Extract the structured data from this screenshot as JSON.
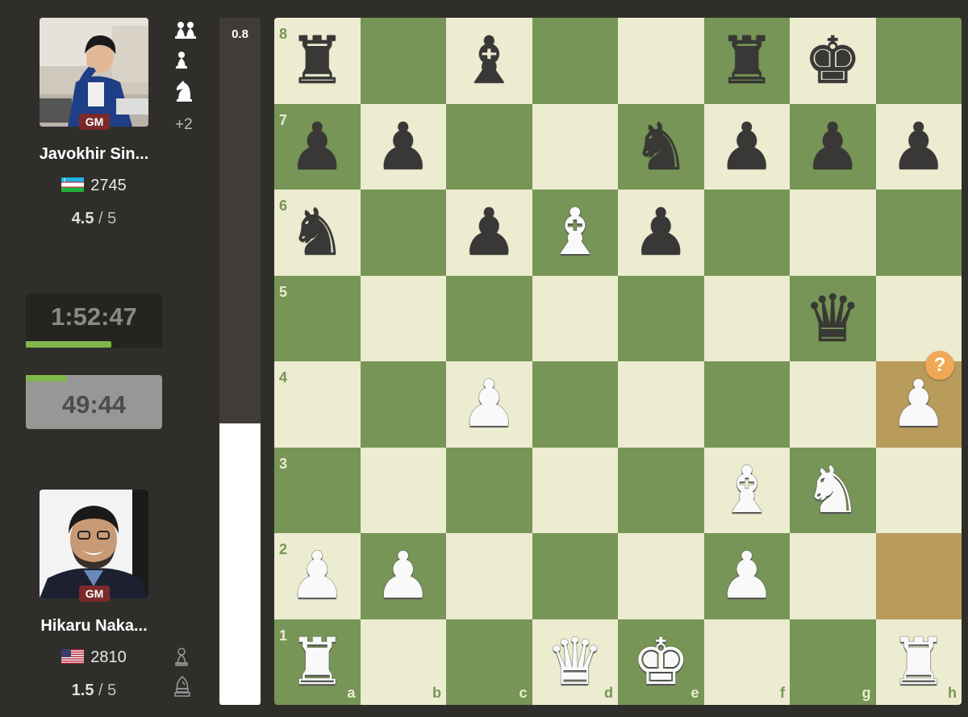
{
  "players": {
    "top": {
      "name": "Javokhir Sin...",
      "title": "GM",
      "rating": "2745",
      "score": "4.5",
      "score_total": " / 5",
      "flag": "uzbekistan-flag",
      "captured_icons": [
        "two-pawns-icon",
        "pawn-icon",
        "knight-icon"
      ],
      "material_advantage": "+2",
      "clock": "1:52:47",
      "clock_bar_fraction": 0.63
    },
    "bottom": {
      "name": "Hikaru Naka...",
      "title": "GM",
      "rating": "2810",
      "score": "1.5",
      "score_total": " / 5",
      "flag": "usa-flag",
      "captured_icons": [
        "pawn-icon",
        "bishop-icon"
      ],
      "clock": "49:44",
      "clock_bar_fraction": 0.3
    }
  },
  "eval": {
    "label": "0.8",
    "white_fraction": 0.41
  },
  "board": {
    "files": [
      "a",
      "b",
      "c",
      "d",
      "e",
      "f",
      "g",
      "h"
    ],
    "ranks": [
      "8",
      "7",
      "6",
      "5",
      "4",
      "3",
      "2",
      "1"
    ],
    "highlight_squares": [
      "h4",
      "h2"
    ],
    "move_annotation": {
      "square": "h4",
      "symbol": "?"
    },
    "pieces": [
      {
        "sq": "a8",
        "p": "br"
      },
      {
        "sq": "c8",
        "p": "bb"
      },
      {
        "sq": "f8",
        "p": "br"
      },
      {
        "sq": "g8",
        "p": "bk"
      },
      {
        "sq": "a7",
        "p": "bp"
      },
      {
        "sq": "b7",
        "p": "bp"
      },
      {
        "sq": "e7",
        "p": "bn"
      },
      {
        "sq": "f7",
        "p": "bp"
      },
      {
        "sq": "g7",
        "p": "bp"
      },
      {
        "sq": "h7",
        "p": "bp"
      },
      {
        "sq": "a6",
        "p": "bn"
      },
      {
        "sq": "c6",
        "p": "bp"
      },
      {
        "sq": "d6",
        "p": "wb"
      },
      {
        "sq": "e6",
        "p": "bp"
      },
      {
        "sq": "g5",
        "p": "bq"
      },
      {
        "sq": "c4",
        "p": "wp"
      },
      {
        "sq": "h4",
        "p": "wp"
      },
      {
        "sq": "f3",
        "p": "wb"
      },
      {
        "sq": "g3",
        "p": "wn"
      },
      {
        "sq": "a2",
        "p": "wp"
      },
      {
        "sq": "b2",
        "p": "wp"
      },
      {
        "sq": "f2",
        "p": "wp"
      },
      {
        "sq": "a1",
        "p": "wr"
      },
      {
        "sq": "d1",
        "p": "wq"
      },
      {
        "sq": "e1",
        "p": "wk"
      },
      {
        "sq": "h1",
        "p": "wr"
      }
    ]
  }
}
